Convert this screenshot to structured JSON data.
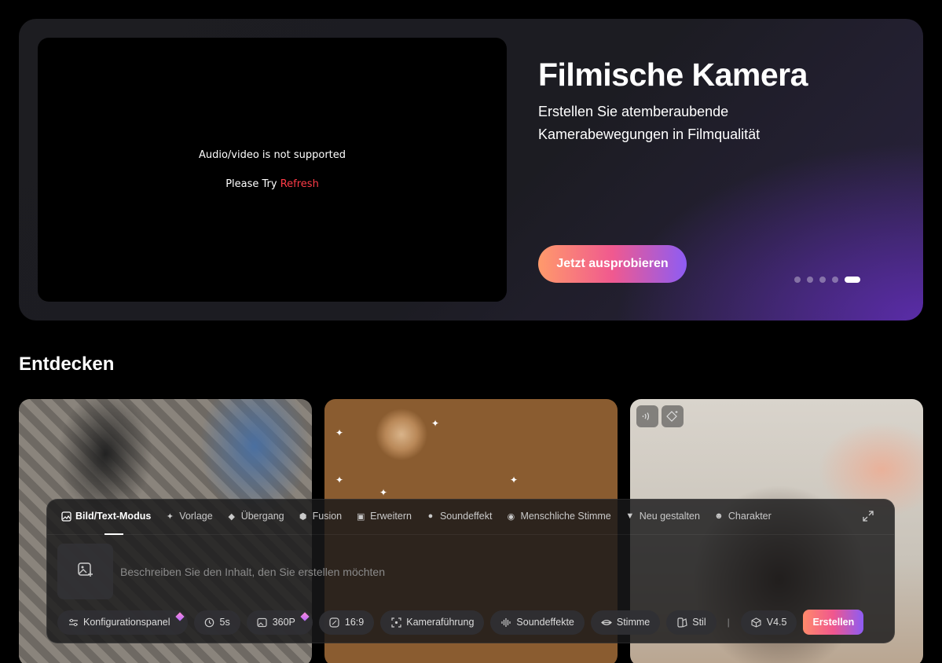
{
  "hero": {
    "video_message": "Audio/video is not supported",
    "video_try": "Please Try",
    "video_refresh": "Refresh",
    "title": "Filmische Kamera",
    "subtitle": "Erstellen Sie atemberaubende Kamerabewegungen in Filmqualität",
    "cta_label": "Jetzt ausprobieren",
    "carousel": {
      "total": 5,
      "active_index": 4
    }
  },
  "discover": {
    "title": "Entdecken",
    "cards": [
      {
        "icons": []
      },
      {
        "icons": []
      },
      {
        "icons": [
          "audio-waves-icon",
          "diamond-sparkle-icon"
        ]
      }
    ]
  },
  "panel": {
    "mode_tabs": [
      {
        "label": "Bild/Text-Modus",
        "icon": "image-icon",
        "active": true
      },
      {
        "label": "Vorlage",
        "icon": "sparkle-icon",
        "active": false
      },
      {
        "label": "Übergang",
        "icon": "transition-icon",
        "active": false
      },
      {
        "label": "Fusion",
        "icon": "cube-icon",
        "active": false
      },
      {
        "label": "Erweitern",
        "icon": "extend-icon",
        "active": false
      },
      {
        "label": "Soundeffekt",
        "icon": "sound-icon",
        "active": false
      },
      {
        "label": "Menschliche Stimme",
        "icon": "lips-icon",
        "active": false
      },
      {
        "label": "Neu gestalten",
        "icon": "brush-icon",
        "active": false
      },
      {
        "label": "Charakter",
        "icon": "face-icon",
        "active": false
      }
    ],
    "prompt_placeholder": "Beschreiben Sie den Inhalt, den Sie erstellen möchten",
    "toolbar": {
      "config": "Konfigurationspanel",
      "duration": "5s",
      "resolution": "360P",
      "ratio": "16:9",
      "camera": "Kameraführung",
      "sfx": "Soundeffekte",
      "voice": "Stimme",
      "style": "Stil",
      "separator": "|",
      "version": "V4.5",
      "create": "Erstellen"
    }
  }
}
